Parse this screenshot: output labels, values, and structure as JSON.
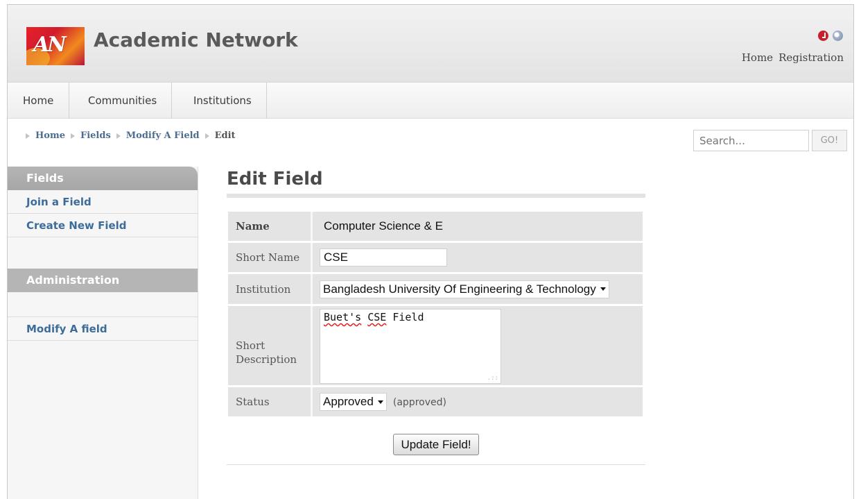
{
  "site": {
    "logo_text": "AN",
    "title": "Academic Network",
    "top_links": [
      "Home",
      "Registration"
    ],
    "icons": [
      "clock-icon",
      "globe-icon"
    ]
  },
  "nav": {
    "items": [
      "Home",
      "Communities",
      "Institutions"
    ]
  },
  "breadcrumb": {
    "items": [
      "Home",
      "Fields",
      "Modify A Field",
      "Edit"
    ]
  },
  "search": {
    "placeholder": "Search...",
    "button_label": "GO!"
  },
  "sidebar": {
    "section1_title": "Fields",
    "section1_links": [
      "Join a Field",
      "Create New Field"
    ],
    "section2_title": "Administration",
    "section2_links": [
      "Modify A field"
    ]
  },
  "form": {
    "title": "Edit Field",
    "name_label": "Name",
    "name_value": "Computer Science & E",
    "short_name_label": "Short Name",
    "short_name_value": "CSE",
    "institution_label": "Institution",
    "institution_value": "Bangladesh University Of Engineering & Technology",
    "description_label": "Short Description",
    "description_word1": "Buet's",
    "description_word2": "CSE",
    "description_word3": "Field",
    "status_label": "Status",
    "status_value": "Approved",
    "status_note": "(approved)",
    "submit_label": "Update Field!"
  },
  "colors": {
    "link": "#3d6c99",
    "sidebar_header": "#b5b5b5",
    "form_cell": "#e4e4e4"
  }
}
